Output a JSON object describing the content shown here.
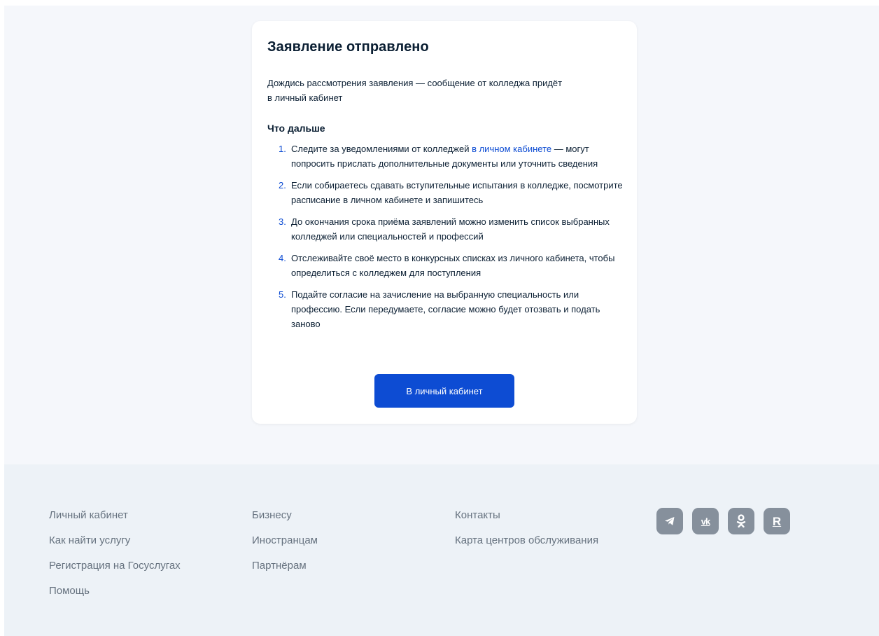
{
  "card": {
    "title": "Заявление отправлено",
    "description_line1": "Дождись рассмотрения заявления — сообщение от колледжа придёт",
    "description_line2": "в личный кабинет",
    "next_title": "Что дальше",
    "steps": [
      {
        "number": "1.",
        "text_before_link": "Следите за уведомлениями от колледжей ",
        "link_text": "в личном кабинете",
        "text_after_link": " — могут попросить прислать дополнительные документы или уточнить сведения"
      },
      {
        "number": "2.",
        "text": "Если собираетесь сдавать вступительные испытания в колледже, посмотрите расписание в личном кабинете и запишитесь"
      },
      {
        "number": "3.",
        "text": "До окончания срока приёма заявлений можно изменить список выбранных колледжей или специальностей и профессий"
      },
      {
        "number": "4.",
        "text": "Отслеживайте своё место в конкурсных списках из личного кабинета, чтобы определиться с колледжем для поступления"
      },
      {
        "number": "5.",
        "text": "Подайте согласие на зачисление на выбранную специальность или профессию. Если передумаете, согласие можно будет отозвать и подать заново"
      }
    ],
    "button_label": "В личный кабинет"
  },
  "footer": {
    "columns": [
      [
        "Личный кабинет",
        "Как найти услугу",
        "Регистрация на Госуслугах",
        "Помощь"
      ],
      [
        "Бизнесу",
        "Иностранцам",
        "Партнёрам"
      ],
      [
        "Контакты",
        "Карта центров обслуживания"
      ]
    ],
    "social": [
      {
        "name": "telegram-icon",
        "glyph": ""
      },
      {
        "name": "vk-icon",
        "glyph": "vk"
      },
      {
        "name": "odnoklassniki-icon",
        "glyph": ""
      },
      {
        "name": "rutube-icon",
        "glyph": "R"
      }
    ]
  },
  "colors": {
    "accent": "#0d4cd3",
    "page_bg": "#f5f7fb",
    "footer_bg": "#edf2f7",
    "footer_text": "#66727f",
    "social_icon_bg": "#86909c"
  }
}
